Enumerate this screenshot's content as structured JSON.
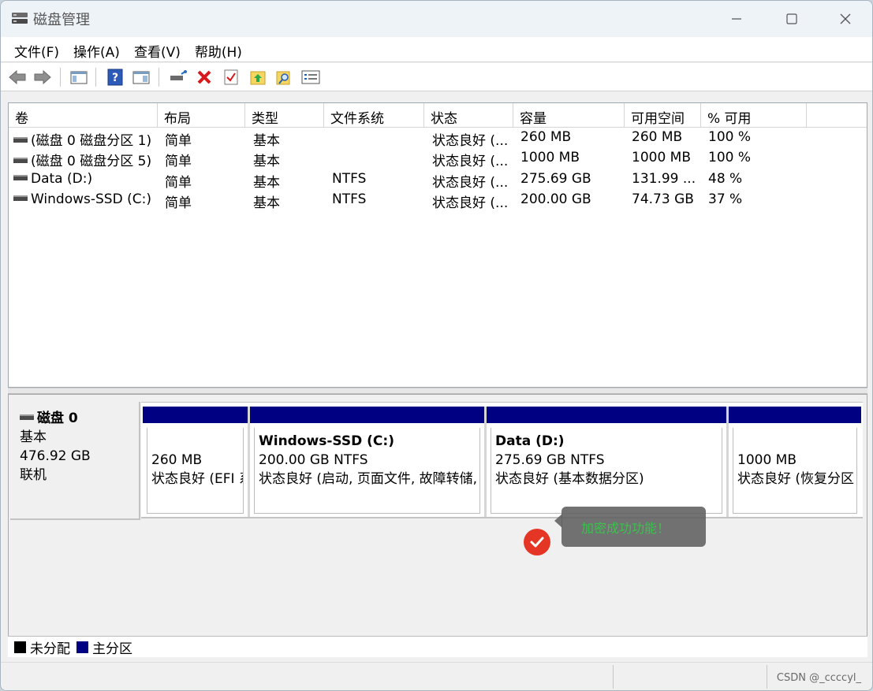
{
  "window": {
    "title": "磁盘管理",
    "controls": [
      "minimize",
      "maximize",
      "close"
    ]
  },
  "menu": [
    "文件(F)",
    "操作(A)",
    "查看(V)",
    "帮助(H)"
  ],
  "toolbar": {
    "icons": [
      "back-arrow-icon",
      "forward-arrow-icon",
      "console-tree-icon",
      "help-icon",
      "show-pane-icon",
      "connect-disk-icon",
      "delete-icon",
      "check-icon",
      "up-folder-icon",
      "find-icon",
      "properties-icon"
    ]
  },
  "volumes": {
    "columns": [
      "卷",
      "布局",
      "类型",
      "文件系统",
      "状态",
      "容量",
      "可用空间",
      "% 可用"
    ],
    "rows": [
      [
        "(磁盘 0 磁盘分区 1)",
        "简单",
        "基本",
        "",
        "状态良好 (...",
        "260 MB",
        "260 MB",
        "100 %"
      ],
      [
        "(磁盘 0 磁盘分区 5)",
        "简单",
        "基本",
        "",
        "状态良好 (...",
        "1000 MB",
        "1000 MB",
        "100 %"
      ],
      [
        "Data (D:)",
        "简单",
        "基本",
        "NTFS",
        "状态良好 (...",
        "275.69 GB",
        "131.99 ...",
        "48 %"
      ],
      [
        "Windows-SSD (C:)",
        "简单",
        "基本",
        "NTFS",
        "状态良好 (...",
        "200.00 GB",
        "74.73 GB",
        "37 %"
      ]
    ]
  },
  "disk": {
    "name": "磁盘 0",
    "type": "基本",
    "size": "476.92 GB",
    "status": "联机",
    "partitions": [
      {
        "label": "",
        "size": "260 MB",
        "status": "状态良好 (EFI 系"
      },
      {
        "label": "Windows-SSD  (C:)",
        "size": "200.00 GB NTFS",
        "status": "状态良好 (启动, 页面文件, 故障转储,"
      },
      {
        "label": "Data  (D:)",
        "size": "275.69 GB NTFS",
        "status": "状态良好 (基本数据分区)"
      },
      {
        "label": "",
        "size": "1000 MB",
        "status": "状态良好 (恢复分区"
      }
    ]
  },
  "toast": {
    "text": "加密成功功能！"
  },
  "legend": [
    {
      "label": "未分配",
      "color": "#000000"
    },
    {
      "label": "主分区",
      "color": "#000082"
    }
  ],
  "watermark": "CSDN @_ccccyl_",
  "colors": {
    "primary_partition": "#000082",
    "success_check": "#e53625",
    "toast_text": "#3cc14e"
  }
}
